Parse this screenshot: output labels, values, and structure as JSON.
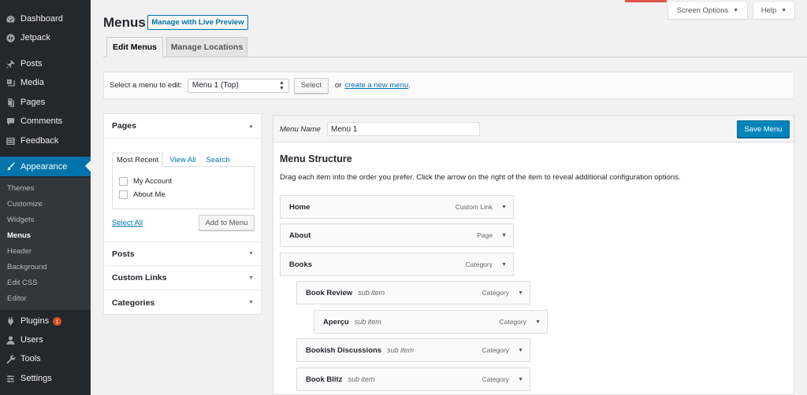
{
  "sidebar": {
    "items": [
      {
        "label": "Dashboard",
        "icon": "dashboard-icon"
      },
      {
        "label": "Jetpack",
        "icon": "jetpack-icon"
      },
      {
        "label": "Posts",
        "icon": "pin-icon"
      },
      {
        "label": "Media",
        "icon": "media-icon"
      },
      {
        "label": "Pages",
        "icon": "pages-icon"
      },
      {
        "label": "Comments",
        "icon": "comment-icon"
      },
      {
        "label": "Feedback",
        "icon": "feedback-icon"
      },
      {
        "label": "Appearance",
        "icon": "paintbrush-icon"
      },
      {
        "label": "Plugins",
        "icon": "plugin-icon",
        "badge": "1"
      },
      {
        "label": "Users",
        "icon": "users-icon"
      },
      {
        "label": "Tools",
        "icon": "wrench-icon"
      },
      {
        "label": "Settings",
        "icon": "settings-icon"
      }
    ],
    "submenu": [
      "Themes",
      "Customize",
      "Widgets",
      "Menus",
      "Header",
      "Background",
      "Edit CSS",
      "Editor"
    ]
  },
  "header": {
    "title": "Menus",
    "live_preview": "Manage with Live Preview",
    "screen_options": "Screen Options",
    "help": "Help"
  },
  "tabs": [
    "Edit Menus",
    "Manage Locations"
  ],
  "manage": {
    "label": "Select a menu to edit:",
    "selected_menu": "Menu 1 (Top)",
    "select_button": "Select",
    "or_text": "or",
    "create_link": "create a new menu",
    "period": "."
  },
  "accordion": {
    "pages": {
      "title": "Pages",
      "tabs": [
        "Most Recent",
        "View All",
        "Search"
      ],
      "items": [
        "My Account",
        "About Me"
      ],
      "select_all": "Select All",
      "add_button": "Add to Menu"
    },
    "sections": [
      "Posts",
      "Custom Links",
      "Categories"
    ]
  },
  "editor": {
    "menu_name_label": "Menu Name",
    "menu_name_value": "Menu 1",
    "save_button": "Save Menu",
    "structure_title": "Menu Structure",
    "structure_desc": "Drag each item into the order you prefer. Click the arrow on the right of the item to reveal additional configuration options.",
    "items": [
      {
        "name": "Home",
        "sub": "",
        "type": "Custom Link"
      },
      {
        "name": "About",
        "sub": "",
        "type": "Page"
      },
      {
        "name": "Books",
        "sub": "",
        "type": "Category"
      },
      {
        "name": "Book Review",
        "sub": "sub item",
        "type": "Category"
      },
      {
        "name": "Aperçu",
        "sub": "sub item",
        "type": "Category"
      },
      {
        "name": "Bookish Discussions",
        "sub": "sub item",
        "type": "Category"
      },
      {
        "name": "Book Blitz",
        "sub": "sub item",
        "type": "Category"
      }
    ]
  },
  "colors": {
    "sidebar_bg": "#23282d",
    "accent": "#0073aa",
    "save_button": "#0085ba",
    "badge": "#d54e21"
  }
}
